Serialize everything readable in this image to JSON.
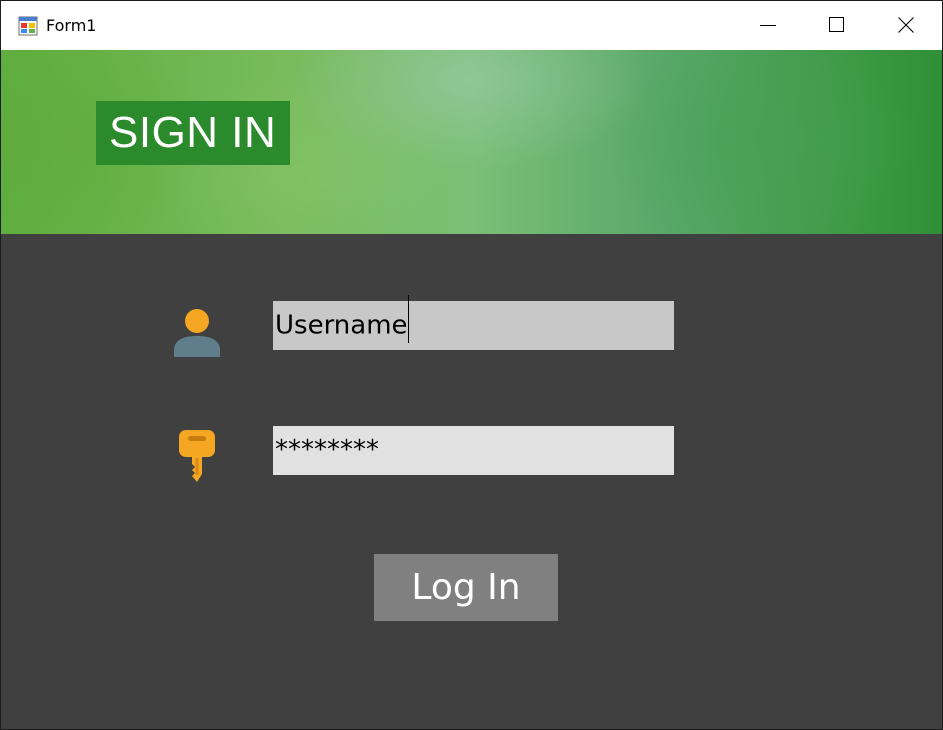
{
  "window": {
    "title": "Form1",
    "app_icon": "windows-form-icon",
    "controls": {
      "minimize_icon": "minimize-icon",
      "maximize_icon": "maximize-icon",
      "close_icon": "close-icon"
    }
  },
  "banner": {
    "heading": "SIGN IN",
    "heading_bg": "#2b8a2b"
  },
  "form": {
    "user_icon": "user-icon",
    "key_icon": "key-icon",
    "username_value": "Username",
    "password_value": "********",
    "login_label": "Log In"
  },
  "colors": {
    "panel_bg": "#404040",
    "username_bg": "#c8c8c8",
    "password_bg": "#e1e1e1",
    "button_bg": "#808080",
    "icon_orange": "#f5a623",
    "user_body": "#607d8b"
  }
}
